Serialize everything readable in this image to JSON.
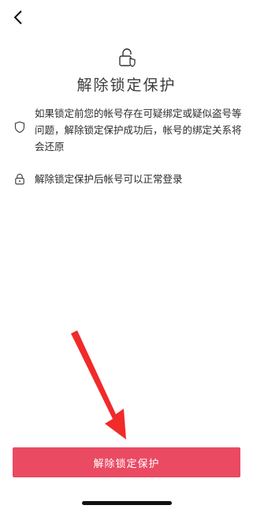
{
  "header": {
    "back_icon": "chevron-left-icon"
  },
  "hero": {
    "icon": "lock-shield-icon",
    "title": "解除锁定保护"
  },
  "info_items": [
    {
      "icon": "shield-icon",
      "text": "如果锁定前您的帐号存在可疑绑定或疑似盗号等问题，解除锁定保护成功后，帐号的绑定关系将会还原"
    },
    {
      "icon": "lock-icon",
      "text": "解除锁定保护后帐号可以正常登录"
    }
  ],
  "footer": {
    "button_label": "解除锁定保护"
  },
  "colors": {
    "accent": "#ea4a62",
    "annotation_arrow": "#f12a2a"
  }
}
